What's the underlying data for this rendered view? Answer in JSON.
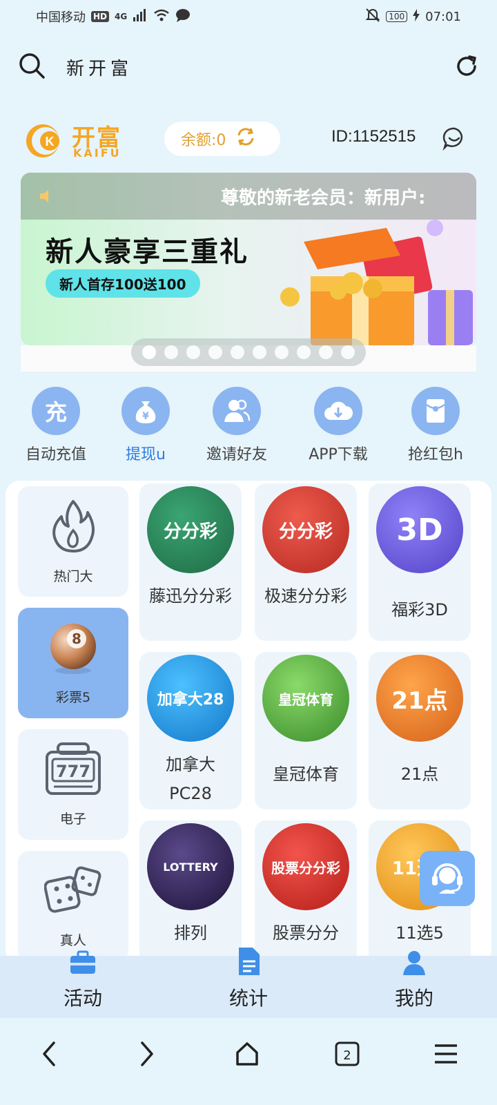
{
  "status_bar": {
    "carrier": "中国移动",
    "hd": "HD",
    "network": "4G",
    "battery": "100",
    "time": "07:01"
  },
  "topbar": {
    "title": "新开富"
  },
  "brand": {
    "logo_zh": "开富",
    "logo_en": "KAIFU",
    "balance_label": "余额:0",
    "user_id": "ID:1152515"
  },
  "banner": {
    "notice": "尊敬的新老会员：新用户:",
    "headline": "新人豪享三重礼",
    "pill": "新人首存100送100",
    "dot_count": 10,
    "active_dot": 0
  },
  "quick_actions": [
    {
      "label": "自动充值",
      "icon": "recharge-icon",
      "glyph": "充"
    },
    {
      "label": "提现u",
      "icon": "money-bag-icon",
      "glyph": "¥",
      "highlight": true
    },
    {
      "label": "邀请好友",
      "icon": "invite-friends-icon",
      "glyph": ""
    },
    {
      "label": "APP下载",
      "icon": "download-cloud-icon",
      "glyph": ""
    },
    {
      "label": "抢红包h",
      "icon": "red-envelope-icon",
      "glyph": ""
    }
  ],
  "categories": [
    {
      "label": "热门大",
      "icon": "fire-icon"
    },
    {
      "label": "彩票5",
      "icon": "lottery-ball-icon",
      "active": true
    },
    {
      "label": "电子",
      "icon": "slot-777-icon"
    },
    {
      "label": "真人",
      "icon": "dice-icon"
    }
  ],
  "games": [
    {
      "label": "藤迅分分彩",
      "icon_text": "分分彩",
      "colors": [
        "#2f8b5f",
        "#1f6a45"
      ]
    },
    {
      "label": "极速分分彩",
      "icon_text": "分分彩",
      "colors": [
        "#e0443a",
        "#b52a22"
      ]
    },
    {
      "label": "福彩3D",
      "icon_text": "3D",
      "colors": [
        "#7b6df0",
        "#5443c8"
      ]
    },
    {
      "label": "加拿大PC28",
      "icon_text": "加拿大28",
      "colors": [
        "#29a9f0",
        "#1477c9"
      ]
    },
    {
      "label": "皇冠体育",
      "icon_text": "皇冠体育",
      "colors": [
        "#63c24a",
        "#3a8a2a"
      ]
    },
    {
      "label": "21点",
      "icon_text": "21点",
      "colors": [
        "#f58a2a",
        "#d4601a"
      ]
    },
    {
      "label": "排列",
      "icon_text": "LOTTERY",
      "colors": [
        "#3a2a6a",
        "#1d1238"
      ]
    },
    {
      "label": "股票分分",
      "icon_text": "股票分分彩",
      "colors": [
        "#e3322c",
        "#b51e18"
      ]
    },
    {
      "label": "11选5",
      "icon_text": "11选5",
      "colors": [
        "#f7b02a",
        "#e08a10"
      ]
    }
  ],
  "tabbar": [
    {
      "label": "活动",
      "icon": "briefcase-icon"
    },
    {
      "label": "统计",
      "icon": "document-icon"
    },
    {
      "label": "我的",
      "icon": "user-icon"
    }
  ],
  "nav": {
    "tabs_count": "2"
  }
}
